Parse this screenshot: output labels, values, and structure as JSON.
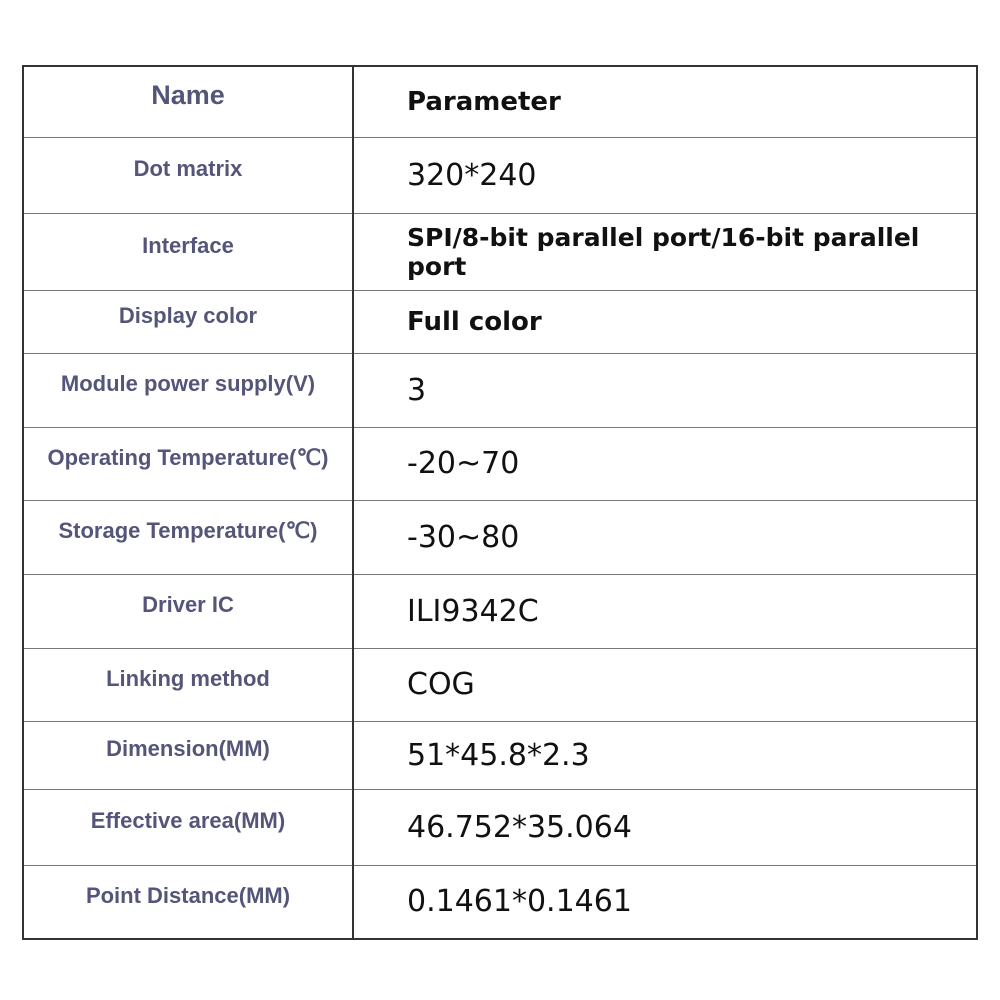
{
  "table": {
    "header": {
      "name": "Name",
      "parameter": "Parameter"
    },
    "rows": [
      {
        "name": "Dot matrix",
        "value": "320*240"
      },
      {
        "name": "Interface",
        "value": "SPI/8-bit parallel port/16-bit parallel port"
      },
      {
        "name": "Display color",
        "value": "Full color"
      },
      {
        "name": "Module power supply(V)",
        "value": "3"
      },
      {
        "name": "Operating Temperature(℃)",
        "value": "-20~70"
      },
      {
        "name": "Storage Temperature(℃)",
        "value": "-30~80"
      },
      {
        "name": "Driver IC",
        "value": "ILI9342C"
      },
      {
        "name": "Linking method",
        "value": "COG"
      },
      {
        "name": "Dimension(MM)",
        "value": "51*45.8*2.3"
      },
      {
        "name": "Effective area(MM)",
        "value": "46.752*35.064"
      },
      {
        "name": "Point Distance(MM)",
        "value": "0.1461*0.1461"
      }
    ]
  }
}
